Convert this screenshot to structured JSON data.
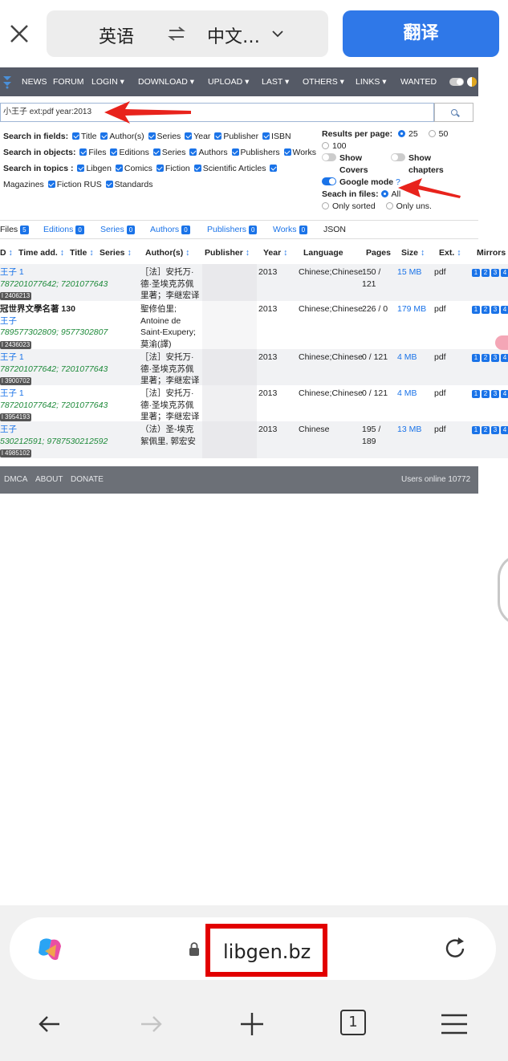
{
  "translate_bar": {
    "source_lang": "英语",
    "target_lang": "中文…",
    "translate_button": "翻译"
  },
  "nav": {
    "items": [
      "NEWS",
      "FORUM",
      "LOGIN ▾",
      "DOWNLOAD ▾",
      "UPLOAD ▾",
      "LAST ▾",
      "OTHERS ▾",
      "LINKS ▾",
      "WANTED"
    ]
  },
  "search": {
    "value": "小王子 ext:pdf year:2013"
  },
  "options": {
    "fields_label": "Search in fields:",
    "fields": [
      "Title",
      "Author(s)",
      "Series",
      "Year",
      "Publisher",
      "ISBN"
    ],
    "objects_label": "Search in objects:",
    "objects": [
      "Files",
      "Editions",
      "Series",
      "Authors",
      "Publishers",
      "Works"
    ],
    "topics_label": "Search in topics :",
    "topics": [
      "Libgen",
      "Comics",
      "Fiction",
      "Scientific Articles",
      "Magazines",
      "Fiction RUS",
      "Standards"
    ]
  },
  "right_options": {
    "results_label": "Results per page:",
    "r25": "25",
    "r50": "50",
    "r100": "100",
    "show_covers": "Show",
    "show_covers2": "Covers",
    "show_chapters": "Show",
    "show_chapters2": "chapters",
    "google_mode": "Google mode",
    "help": "?",
    "seach_files_label": "Seach in files:",
    "all": "All",
    "only_sorted": "Only sorted",
    "only_uns": "Only uns."
  },
  "tabs": [
    {
      "label": "Files",
      "count": "5"
    },
    {
      "label": "Editions",
      "count": "0"
    },
    {
      "label": "Series",
      "count": "0"
    },
    {
      "label": "Authors",
      "count": "0"
    },
    {
      "label": "Publishers",
      "count": "0"
    },
    {
      "label": "Works",
      "count": "0"
    },
    {
      "label": "JSON",
      "count": ""
    }
  ],
  "columns": {
    "id": "D",
    "time": "Time add.",
    "title": "Title",
    "series": "Series",
    "author": "Author(s)",
    "publisher": "Publisher",
    "year": "Year",
    "language": "Language",
    "pages": "Pages",
    "size": "Size",
    "ext": "Ext.",
    "mirrors": "Mirrors"
  },
  "rows": [
    {
      "title": "王子 1",
      "isbn": "787201077642; 7201077643",
      "id": "l 2406213",
      "author1": "［法］安托万·",
      "author2": "德·圣埃克苏佩",
      "author3": "里著；李继宏译",
      "year": "2013",
      "language": "Chinese;Chinese",
      "pages1": "150 /",
      "pages2": "121",
      "size": "15 MB",
      "ext": "pdf"
    },
    {
      "title": "冠世界文學名著 130",
      "sub": "王子",
      "isbn": "789577302809; 9577302807",
      "id": "l 2436023",
      "author1": "聖修伯里;",
      "author2": "Antoine de",
      "author3": "Saint-Exupery;",
      "author4": "莫渝(譯)",
      "year": "2013",
      "language": "Chinese;Chinese",
      "pages1": "226 / 0",
      "pages2": "",
      "size": "179 MB",
      "ext": "pdf"
    },
    {
      "title": "王子 1",
      "isbn": "787201077642; 7201077643",
      "id": "l 3900702",
      "author1": "［法］安托万·",
      "author2": "德·圣埃克苏佩",
      "author3": "里著；李继宏译",
      "year": "2013",
      "language": "Chinese;Chinese",
      "pages1": "0 / 121",
      "pages2": "",
      "size": "4 MB",
      "ext": "pdf"
    },
    {
      "title": "王子 1",
      "isbn": "787201077642; 7201077643",
      "id": "l 3954193",
      "author1": "［法］安托万·",
      "author2": "德·圣埃克苏佩",
      "author3": "里著；李继宏译",
      "year": "2013",
      "language": "Chinese;Chinese",
      "pages1": "0 / 121",
      "pages2": "",
      "size": "4 MB",
      "ext": "pdf"
    },
    {
      "title": "王子",
      "isbn": "530212591; 9787530212592",
      "id": "l 4985102",
      "author1": "（法）圣-埃克",
      "author2": "絮佩里, 郭宏安",
      "author3": "",
      "year": "2013",
      "language": "Chinese",
      "pages1": "195 /",
      "pages2": "189",
      "size": "13 MB",
      "ext": "pdf"
    }
  ],
  "mirrors": [
    "1",
    "2",
    "3",
    "4"
  ],
  "footer": {
    "dmca": "DMCA",
    "about": "ABOUT",
    "donate": "DONATE",
    "users": "Users online 10772"
  },
  "browser": {
    "url": "libgen.bz",
    "tab_count": "1"
  },
  "colors": {
    "accent": "#1a73e8",
    "translate_button": "#2f78e8",
    "highlight": "#e20000"
  }
}
